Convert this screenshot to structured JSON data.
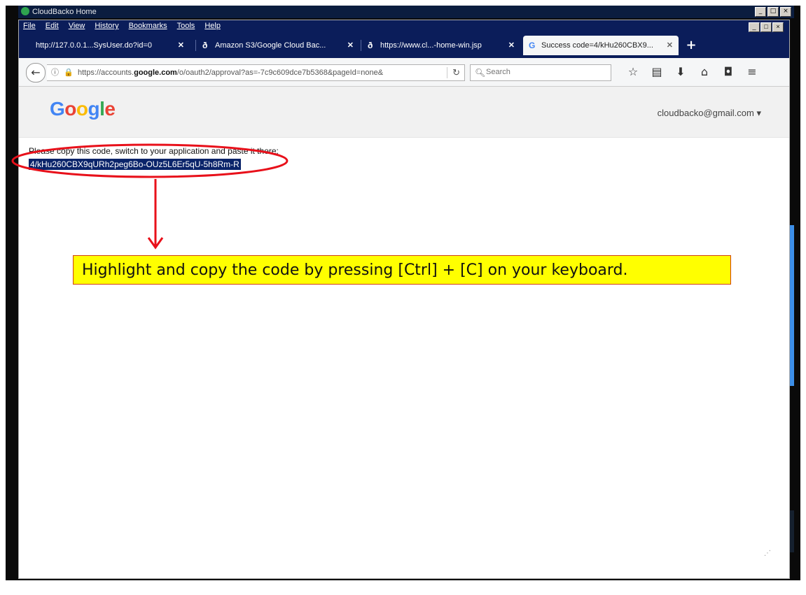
{
  "os_window": {
    "title": "CloudBacko Home"
  },
  "menu": [
    "File",
    "Edit",
    "View",
    "History",
    "Bookmarks",
    "Tools",
    "Help"
  ],
  "tabs": [
    {
      "label": "http://127.0.0.1...SysUser.do?id=0",
      "active": false,
      "icon": "page-icon"
    },
    {
      "label": "Amazon S3/Google Cloud Bac...",
      "active": false,
      "icon": "cloudbacko-icon"
    },
    {
      "label": "https://www.cl...-home-win.jsp",
      "active": false,
      "icon": "cloudbacko-icon"
    },
    {
      "label": "Success code=4/kHu260CBX9...",
      "active": true,
      "icon": "google-icon"
    }
  ],
  "newtab_label": "+",
  "navbar": {
    "url_prefix": "https://accounts.",
    "url_domain": "google.com",
    "url_rest": "/o/oauth2/approval?as=-7c9c609dce7b5368&pageId=none&",
    "search_placeholder": "Search"
  },
  "page": {
    "logo": [
      "G",
      "o",
      "o",
      "g",
      "l",
      "e"
    ],
    "account": "cloudbacko@gmail.com ▾",
    "instruction": "Please copy this code, switch to your application and paste it there:",
    "code": "4/kHu260CBX9qURh2peg6Bo-OUz5L6Er5qU-5h8Rm-R"
  },
  "callout": "Highlight and copy the code by pressing [Ctrl] + [C] on your keyboard.",
  "colors": {
    "annotation": "#e8101a",
    "callout_bg": "#ffff00",
    "selection": "#0a246a",
    "chrome_dark": "#0b1d5a"
  }
}
